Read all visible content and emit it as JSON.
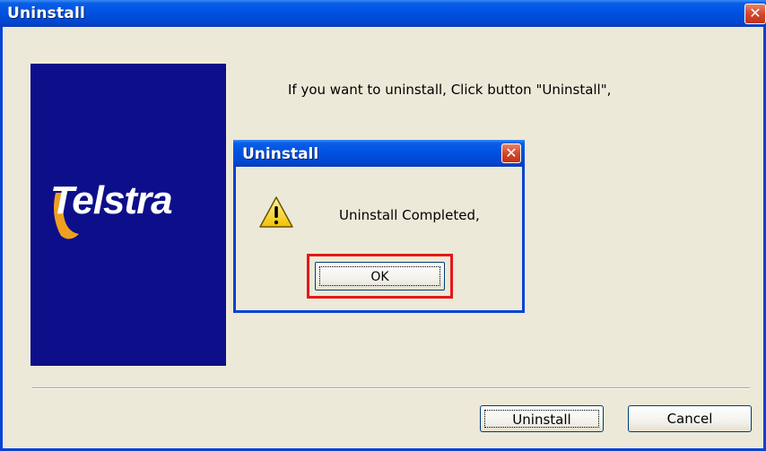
{
  "window": {
    "title": "Uninstall",
    "close_glyph": "✕",
    "instruction": "If you want to uninstall, Click button  \"Uninstall\",",
    "logo_text": "Telstra",
    "buttons": {
      "uninstall": "Uninstall",
      "cancel": "Cancel"
    }
  },
  "dialog": {
    "title": "Uninstall",
    "close_glyph": "✕",
    "message": "Uninstall Completed,",
    "icon": "warning-icon",
    "ok_label": "OK"
  },
  "colors": {
    "titlebar": "#0054e3",
    "logo_bg": "#0d0f8a",
    "highlight": "#e51818",
    "face": "#ece9d8",
    "logo_accent": "#f0a020"
  }
}
